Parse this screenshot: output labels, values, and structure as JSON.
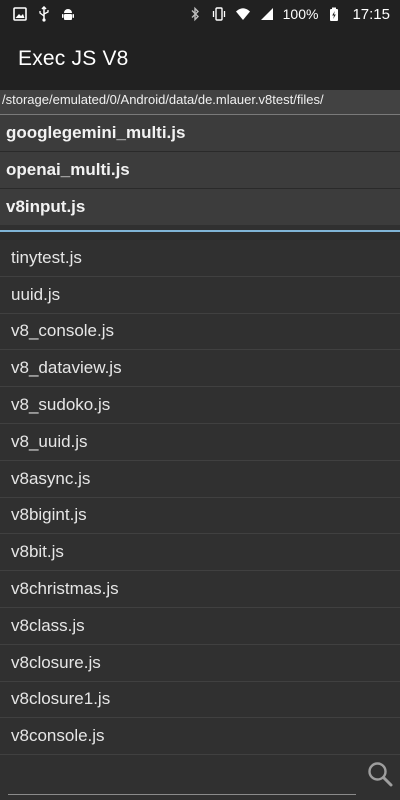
{
  "status_bar": {
    "left_icons": [
      "image-icon",
      "usb-icon",
      "android-debug-icon"
    ],
    "right_icons": [
      "bluetooth-icon",
      "vibrate-icon",
      "wifi-icon",
      "signal-icon",
      "battery-charging-icon"
    ],
    "battery_percent": "100%",
    "time": "17:15"
  },
  "app_bar": {
    "title": "Exec JS V8"
  },
  "path": "/storage/emulated/0/Android/data/de.mlauer.v8test/files/",
  "recent_files": [
    {
      "label": "googlegemini_multi.js"
    },
    {
      "label": "openai_multi.js"
    },
    {
      "label": "v8input.js"
    }
  ],
  "files": [
    {
      "label": "tinytest.js"
    },
    {
      "label": "uuid.js"
    },
    {
      "label": "v8_console.js"
    },
    {
      "label": "v8_dataview.js"
    },
    {
      "label": "v8_sudoko.js"
    },
    {
      "label": "v8_uuid.js"
    },
    {
      "label": "v8async.js"
    },
    {
      "label": "v8bigint.js"
    },
    {
      "label": "v8bit.js"
    },
    {
      "label": "v8christmas.js"
    },
    {
      "label": "v8class.js"
    },
    {
      "label": "v8closure.js"
    },
    {
      "label": "v8closure1.js"
    },
    {
      "label": "v8console.js"
    }
  ],
  "search": {
    "value": "",
    "placeholder": "",
    "button_icon": "search-icon"
  },
  "colors": {
    "accent": "#7fb3d5",
    "app_bar": "#212121",
    "background": "#303030"
  }
}
